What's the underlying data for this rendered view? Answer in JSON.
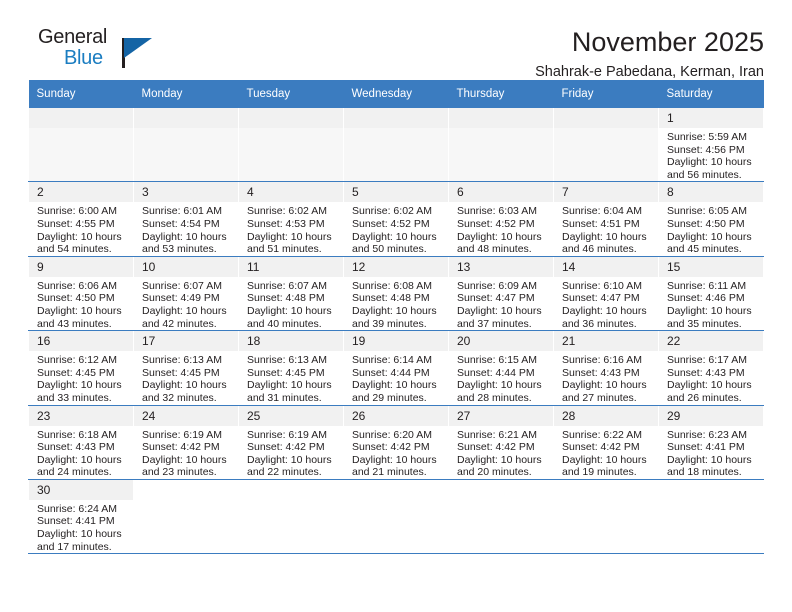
{
  "logo": {
    "line1": "General",
    "line2": "Blue",
    "triangle_color": "#1464a5",
    "blue_text_color": "#1b7dc1"
  },
  "header": {
    "title": "November 2025",
    "subtitle": "Shahrak-e Pabedana, Kerman, Iran",
    "header_bg": "#3b7cc0",
    "header_text_color": "#ffffff"
  },
  "weekdays": [
    "Sunday",
    "Monday",
    "Tuesday",
    "Wednesday",
    "Thursday",
    "Friday",
    "Saturday"
  ],
  "labels": {
    "sunrise": "Sunrise:",
    "sunset": "Sunset:",
    "daylight": "Daylight:"
  },
  "weeks": [
    [
      {
        "day": "",
        "blank": true
      },
      {
        "day": "",
        "blank": true
      },
      {
        "day": "",
        "blank": true
      },
      {
        "day": "",
        "blank": true
      },
      {
        "day": "",
        "blank": true
      },
      {
        "day": "",
        "blank": true
      },
      {
        "day": "1",
        "sunrise": "Sunrise: 5:59 AM",
        "sunset": "Sunset: 4:56 PM",
        "daylight_1": "Daylight: 10 hours",
        "daylight_2": "and 56 minutes."
      }
    ],
    [
      {
        "day": "2",
        "sunrise": "Sunrise: 6:00 AM",
        "sunset": "Sunset: 4:55 PM",
        "daylight_1": "Daylight: 10 hours",
        "daylight_2": "and 54 minutes."
      },
      {
        "day": "3",
        "sunrise": "Sunrise: 6:01 AM",
        "sunset": "Sunset: 4:54 PM",
        "daylight_1": "Daylight: 10 hours",
        "daylight_2": "and 53 minutes."
      },
      {
        "day": "4",
        "sunrise": "Sunrise: 6:02 AM",
        "sunset": "Sunset: 4:53 PM",
        "daylight_1": "Daylight: 10 hours",
        "daylight_2": "and 51 minutes."
      },
      {
        "day": "5",
        "sunrise": "Sunrise: 6:02 AM",
        "sunset": "Sunset: 4:52 PM",
        "daylight_1": "Daylight: 10 hours",
        "daylight_2": "and 50 minutes."
      },
      {
        "day": "6",
        "sunrise": "Sunrise: 6:03 AM",
        "sunset": "Sunset: 4:52 PM",
        "daylight_1": "Daylight: 10 hours",
        "daylight_2": "and 48 minutes."
      },
      {
        "day": "7",
        "sunrise": "Sunrise: 6:04 AM",
        "sunset": "Sunset: 4:51 PM",
        "daylight_1": "Daylight: 10 hours",
        "daylight_2": "and 46 minutes."
      },
      {
        "day": "8",
        "sunrise": "Sunrise: 6:05 AM",
        "sunset": "Sunset: 4:50 PM",
        "daylight_1": "Daylight: 10 hours",
        "daylight_2": "and 45 minutes."
      }
    ],
    [
      {
        "day": "9",
        "sunrise": "Sunrise: 6:06 AM",
        "sunset": "Sunset: 4:50 PM",
        "daylight_1": "Daylight: 10 hours",
        "daylight_2": "and 43 minutes."
      },
      {
        "day": "10",
        "sunrise": "Sunrise: 6:07 AM",
        "sunset": "Sunset: 4:49 PM",
        "daylight_1": "Daylight: 10 hours",
        "daylight_2": "and 42 minutes."
      },
      {
        "day": "11",
        "sunrise": "Sunrise: 6:07 AM",
        "sunset": "Sunset: 4:48 PM",
        "daylight_1": "Daylight: 10 hours",
        "daylight_2": "and 40 minutes."
      },
      {
        "day": "12",
        "sunrise": "Sunrise: 6:08 AM",
        "sunset": "Sunset: 4:48 PM",
        "daylight_1": "Daylight: 10 hours",
        "daylight_2": "and 39 minutes."
      },
      {
        "day": "13",
        "sunrise": "Sunrise: 6:09 AM",
        "sunset": "Sunset: 4:47 PM",
        "daylight_1": "Daylight: 10 hours",
        "daylight_2": "and 37 minutes."
      },
      {
        "day": "14",
        "sunrise": "Sunrise: 6:10 AM",
        "sunset": "Sunset: 4:47 PM",
        "daylight_1": "Daylight: 10 hours",
        "daylight_2": "and 36 minutes."
      },
      {
        "day": "15",
        "sunrise": "Sunrise: 6:11 AM",
        "sunset": "Sunset: 4:46 PM",
        "daylight_1": "Daylight: 10 hours",
        "daylight_2": "and 35 minutes."
      }
    ],
    [
      {
        "day": "16",
        "sunrise": "Sunrise: 6:12 AM",
        "sunset": "Sunset: 4:45 PM",
        "daylight_1": "Daylight: 10 hours",
        "daylight_2": "and 33 minutes."
      },
      {
        "day": "17",
        "sunrise": "Sunrise: 6:13 AM",
        "sunset": "Sunset: 4:45 PM",
        "daylight_1": "Daylight: 10 hours",
        "daylight_2": "and 32 minutes."
      },
      {
        "day": "18",
        "sunrise": "Sunrise: 6:13 AM",
        "sunset": "Sunset: 4:45 PM",
        "daylight_1": "Daylight: 10 hours",
        "daylight_2": "and 31 minutes."
      },
      {
        "day": "19",
        "sunrise": "Sunrise: 6:14 AM",
        "sunset": "Sunset: 4:44 PM",
        "daylight_1": "Daylight: 10 hours",
        "daylight_2": "and 29 minutes."
      },
      {
        "day": "20",
        "sunrise": "Sunrise: 6:15 AM",
        "sunset": "Sunset: 4:44 PM",
        "daylight_1": "Daylight: 10 hours",
        "daylight_2": "and 28 minutes."
      },
      {
        "day": "21",
        "sunrise": "Sunrise: 6:16 AM",
        "sunset": "Sunset: 4:43 PM",
        "daylight_1": "Daylight: 10 hours",
        "daylight_2": "and 27 minutes."
      },
      {
        "day": "22",
        "sunrise": "Sunrise: 6:17 AM",
        "sunset": "Sunset: 4:43 PM",
        "daylight_1": "Daylight: 10 hours",
        "daylight_2": "and 26 minutes."
      }
    ],
    [
      {
        "day": "23",
        "sunrise": "Sunrise: 6:18 AM",
        "sunset": "Sunset: 4:43 PM",
        "daylight_1": "Daylight: 10 hours",
        "daylight_2": "and 24 minutes."
      },
      {
        "day": "24",
        "sunrise": "Sunrise: 6:19 AM",
        "sunset": "Sunset: 4:42 PM",
        "daylight_1": "Daylight: 10 hours",
        "daylight_2": "and 23 minutes."
      },
      {
        "day": "25",
        "sunrise": "Sunrise: 6:19 AM",
        "sunset": "Sunset: 4:42 PM",
        "daylight_1": "Daylight: 10 hours",
        "daylight_2": "and 22 minutes."
      },
      {
        "day": "26",
        "sunrise": "Sunrise: 6:20 AM",
        "sunset": "Sunset: 4:42 PM",
        "daylight_1": "Daylight: 10 hours",
        "daylight_2": "and 21 minutes."
      },
      {
        "day": "27",
        "sunrise": "Sunrise: 6:21 AM",
        "sunset": "Sunset: 4:42 PM",
        "daylight_1": "Daylight: 10 hours",
        "daylight_2": "and 20 minutes."
      },
      {
        "day": "28",
        "sunrise": "Sunrise: 6:22 AM",
        "sunset": "Sunset: 4:42 PM",
        "daylight_1": "Daylight: 10 hours",
        "daylight_2": "and 19 minutes."
      },
      {
        "day": "29",
        "sunrise": "Sunrise: 6:23 AM",
        "sunset": "Sunset: 4:41 PM",
        "daylight_1": "Daylight: 10 hours",
        "daylight_2": "and 18 minutes."
      }
    ],
    [
      {
        "day": "30",
        "sunrise": "Sunrise: 6:24 AM",
        "sunset": "Sunset: 4:41 PM",
        "daylight_1": "Daylight: 10 hours",
        "daylight_2": "and 17 minutes."
      },
      {
        "day": "",
        "blank": true,
        "trailing": true
      },
      {
        "day": "",
        "blank": true,
        "trailing": true
      },
      {
        "day": "",
        "blank": true,
        "trailing": true
      },
      {
        "day": "",
        "blank": true,
        "trailing": true
      },
      {
        "day": "",
        "blank": true,
        "trailing": true
      },
      {
        "day": "",
        "blank": true,
        "trailing": true
      }
    ]
  ]
}
